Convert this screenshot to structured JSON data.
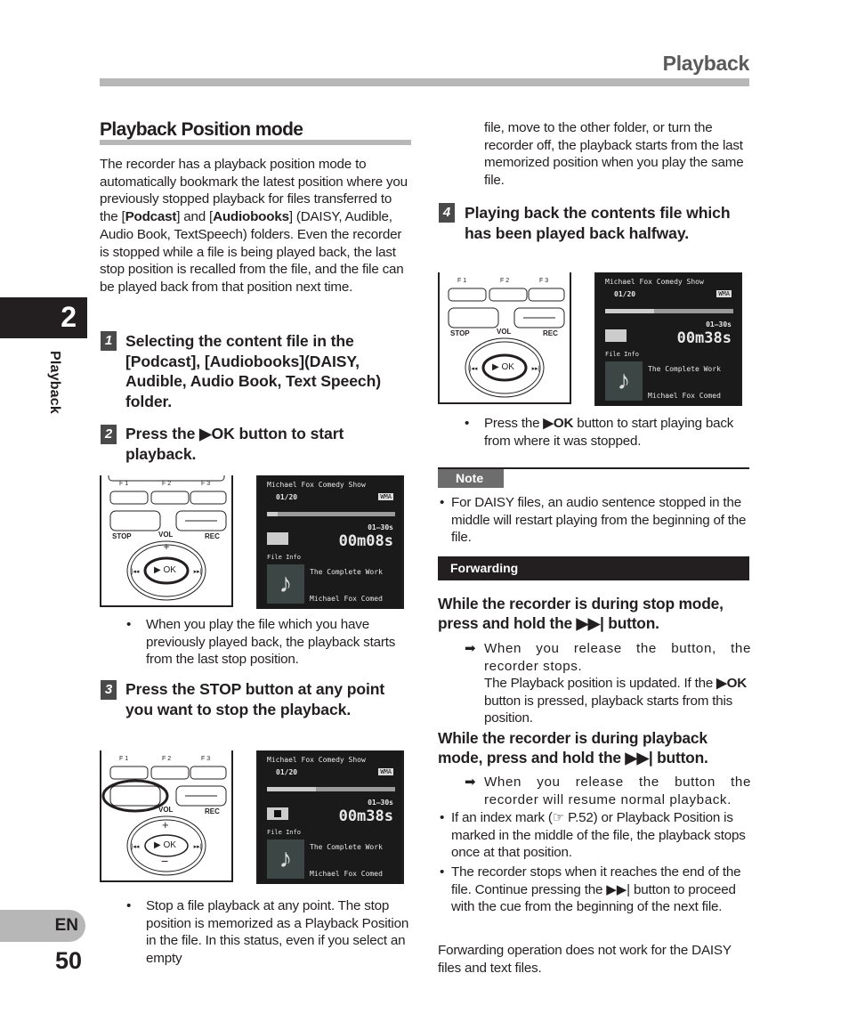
{
  "header": {
    "title": "Playback"
  },
  "chapter": {
    "number": "2",
    "label": "Playback"
  },
  "footer": {
    "lang": "EN",
    "page": "50"
  },
  "section": {
    "title": "Playback Position mode",
    "intro_1": "The recorder has a playback position mode to automatically bookmark the latest position where you previously stopped playback for files transferred to the [",
    "intro_podcast": "Podcast",
    "intro_2": "] and [",
    "intro_audiobooks": "Audiobooks",
    "intro_3": "] (DAISY, Audible, Audio Book, TextSpeech) folders. Even the recorder is stopped while a file is being played back, the last stop position is recalled from the file, and the file can be played back from that position next time."
  },
  "steps": [
    {
      "num": "1",
      "text": "Selecting the content file in the [Podcast], [Audiobooks](DAISY, Audible, Audio Book, Text Speech) folder."
    },
    {
      "num": "2",
      "text_pre": "Press the ",
      "key": "▶OK",
      "text_post": " button to start playback.",
      "bullet": "When you play the file which you have previously played back, the playback starts from the last stop position."
    },
    {
      "num": "3",
      "text_pre": "Press the ",
      "key": "STOP",
      "text_post": " button at any point you want to stop the playback.",
      "bullet": "Stop a file playback at any point. The stop position is memorized as a Playback Position in the file. In this status, even if you select an empty",
      "continued": "file, move to the other folder, or turn the recorder off, the playback starts from the last memorized position when you play the same file."
    },
    {
      "num": "4",
      "text": "Playing back the contents file which has been played back halfway.",
      "bullet_pre": "Press the ",
      "bullet_key": "▶OK",
      "bullet_post": " button to start playing back from where it was stopped."
    }
  ],
  "device": {
    "f1": "F 1",
    "f2": "F 2",
    "f3": "F 3",
    "stop": "STOP",
    "vol": "VOL",
    "rec": "REC",
    "ok": "▶ OK",
    "plus": "+",
    "minus": "−"
  },
  "screens": [
    {
      "folder": "Michael Fox Comedy Show",
      "track": "01/20",
      "format": "WMA",
      "total": "01–30s",
      "elapsed": "00m08s",
      "state": "play",
      "fileinfo": "File Info",
      "song": "The Complete Work",
      "artist": "Michael Fox Comed"
    },
    {
      "folder": "Michael Fox Comedy Show",
      "track": "01/20",
      "format": "WMA",
      "total": "01–30s",
      "elapsed": "00m38s",
      "state": "stop",
      "fileinfo": "File Info",
      "song": "The Complete Work",
      "artist": "Michael Fox Comed"
    },
    {
      "folder": "Michael Fox Comedy Show",
      "track": "01/20",
      "format": "WMA",
      "total": "01–30s",
      "elapsed": "00m38s",
      "state": "play",
      "fileinfo": "File Info",
      "song": "The Complete Work",
      "artist": "Michael Fox Comed"
    }
  ],
  "note": {
    "label": "Note",
    "bullet": "For DAISY files, an audio sentence stopped in the middle will restart playing from the beginning of the file."
  },
  "forwarding": {
    "label": "Forwarding",
    "stop_mode_heading": "While the recorder is during stop mode, press and hold the ▶▶| button.",
    "stop_mode_result_1": "When you release the button, the recorder stops.",
    "stop_mode_result_2_pre": "The Playback position is updated. If the ",
    "stop_mode_result_2_key": "▶OK",
    "stop_mode_result_2_post": " button is pressed, playback starts from this position.",
    "play_mode_heading": "While the recorder is during playback mode, press and hold the ▶▶| button.",
    "play_mode_result": "When you release the button the recorder will resume normal playback.",
    "bullets": [
      "If an index mark (☞ P.52) or Playback Position is marked in the middle of the file, the playback stops once at that position.",
      "The recorder stops when it reaches the end of the file. Continue pressing the ▶▶| button to proceed with the cue from the beginning of the next file."
    ],
    "footer_note": "Forwarding operation does not work for the DAISY files and text files."
  }
}
